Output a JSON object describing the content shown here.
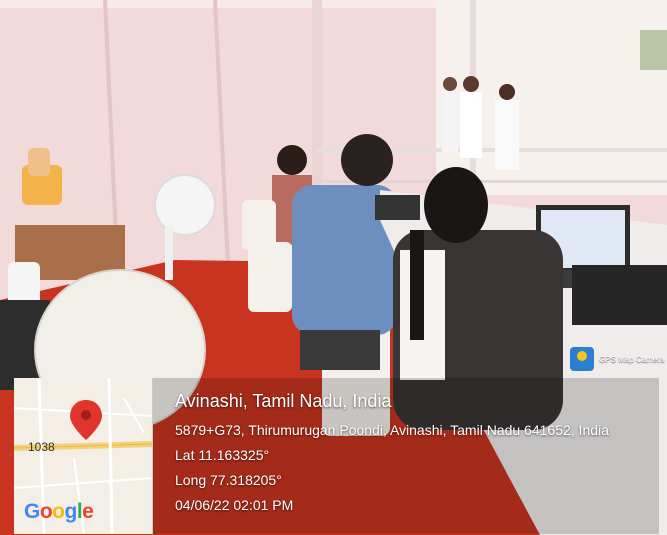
{
  "photo": {
    "palette": {
      "tent_wall": "#f2dada",
      "tent_frame": "#e8cfcf",
      "carpet": "#c8341f",
      "window": "#f7f1ee",
      "desk": "#f0ecec",
      "shirt_blue": "#6c8fbf",
      "dark_clothes": "#3a3535",
      "chair": "#f4f1ec"
    }
  },
  "geotag": {
    "map": {
      "road_label": "1038",
      "logo": [
        "G",
        "o",
        "o",
        "g",
        "l",
        "e"
      ],
      "logo_colors": [
        "#4285F4",
        "#EA4335",
        "#FBBC05",
        "#4285F4",
        "#34A853",
        "#EA4335"
      ],
      "pin_color": "#e0352b"
    },
    "location_title": "Avinashi, Tamil Nadu, India",
    "address": "5879+G73, Thirumurugan Poondi, Avinashi, Tamil Nadu 641652, India",
    "lat": "Lat 11.163325°",
    "long": "Long 77.318205°",
    "datetime": "04/06/22 02:01 PM",
    "watermark": "GPS Map Camera"
  }
}
